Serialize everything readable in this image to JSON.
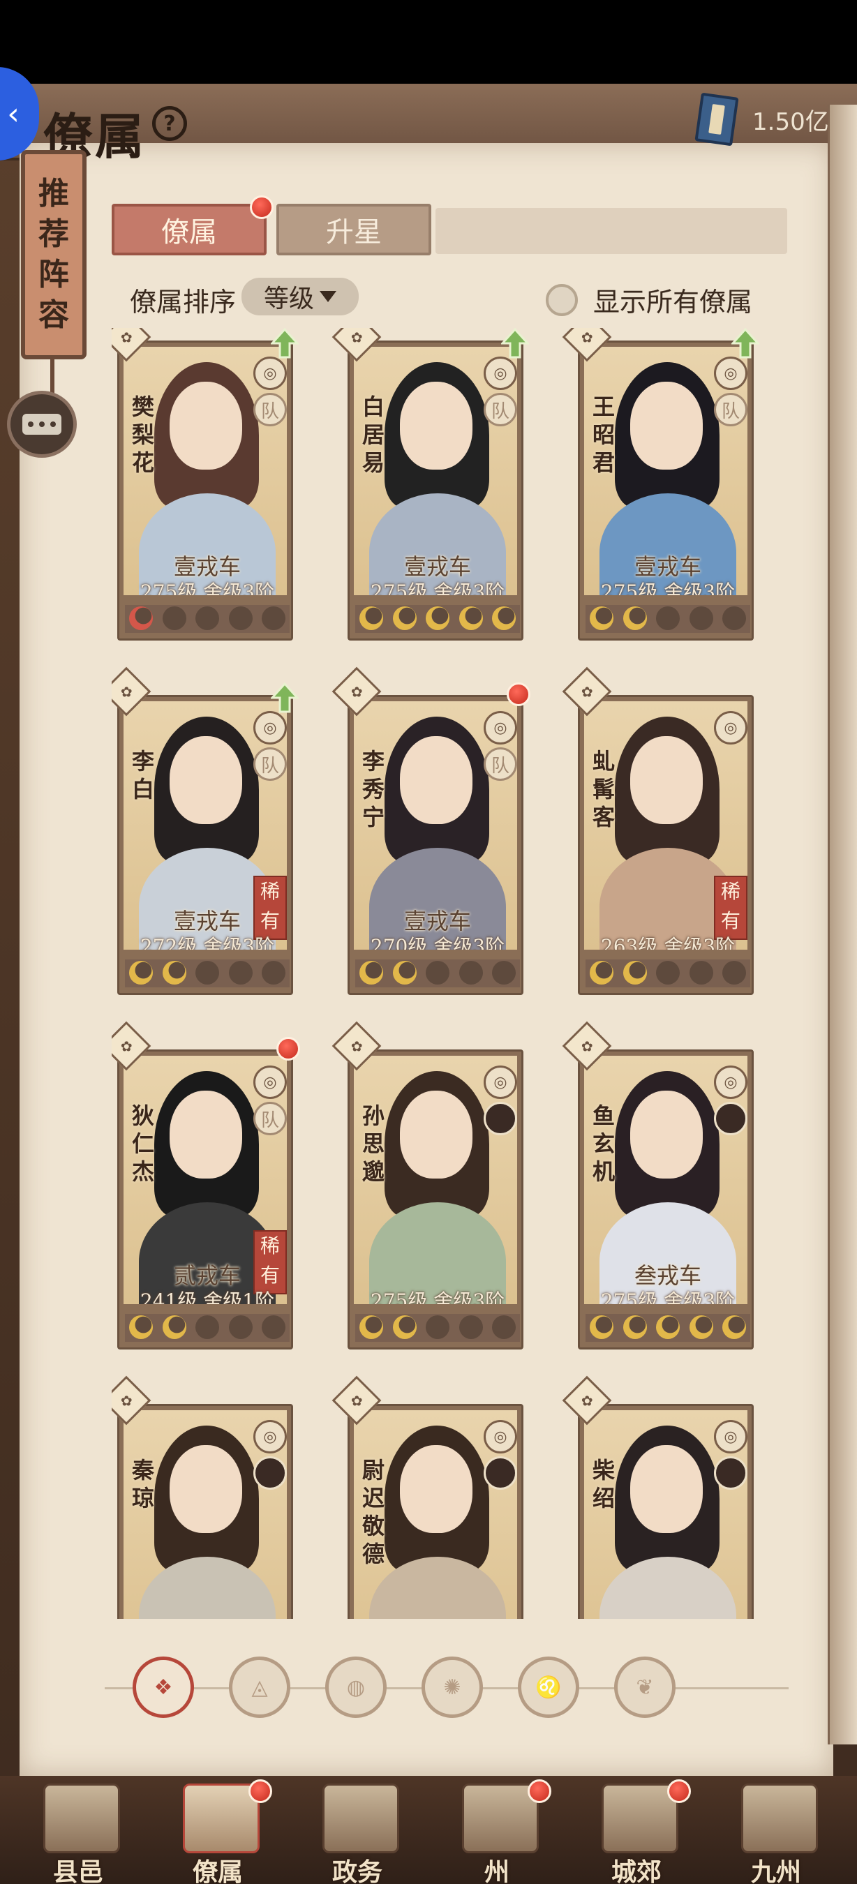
{
  "header": {
    "title": "僚属",
    "help": "?",
    "currency_value": "1.50亿"
  },
  "sidebar": {
    "recommend_label": [
      "推",
      "荐",
      "阵",
      "容"
    ]
  },
  "tabs": [
    {
      "label": "僚属",
      "active": true,
      "dot": true
    },
    {
      "label": "升星",
      "active": false,
      "dot": false
    }
  ],
  "sort": {
    "label": "僚属排序",
    "value": "等级",
    "show_all_label": "显示所有僚属"
  },
  "cards": [
    {
      "name": "樊梨花",
      "rank": "壹戎车",
      "level": "275级",
      "stage": "舍级3阶",
      "stars": 1,
      "star_color": "red",
      "upgrade": true,
      "rare": false,
      "team": "队",
      "dot": false
    },
    {
      "name": "白居易",
      "rank": "壹戎车",
      "level": "275级",
      "stage": "舍级3阶",
      "stars": 5,
      "star_color": "gold",
      "upgrade": true,
      "rare": false,
      "team": "队",
      "dot": false
    },
    {
      "name": "王昭君",
      "rank": "壹戎车",
      "level": "275级",
      "stage": "舍级3阶",
      "stars": 2,
      "star_color": "gold",
      "upgrade": true,
      "rare": false,
      "team": "队",
      "dot": false
    },
    {
      "name": "李白",
      "rank": "壹戎车",
      "level": "272级",
      "stage": "舍级3阶",
      "stars": 2,
      "star_color": "gold",
      "upgrade": true,
      "rare": true,
      "team": "队",
      "dot": false
    },
    {
      "name": "李秀宁",
      "rank": "壹戎车",
      "level": "270级",
      "stage": "舍级3阶",
      "stars": 2,
      "star_color": "gold",
      "upgrade": false,
      "rare": false,
      "team": "队",
      "dot": true
    },
    {
      "name": "虬髯客",
      "rank": "",
      "level": "263级",
      "stage": "舍级3阶",
      "stars": 2,
      "star_color": "gold",
      "upgrade": false,
      "rare": true,
      "team": "",
      "dot": false
    },
    {
      "name": "狄仁杰",
      "rank": "贰戎车",
      "level": "241级",
      "stage": "舍级1阶",
      "stars": 2,
      "star_color": "gold",
      "upgrade": false,
      "rare": true,
      "team": "队",
      "dot": true
    },
    {
      "name": "孙思邈",
      "rank": "",
      "level": "275级",
      "stage": "舍级3阶",
      "stars": 2,
      "star_color": "gold",
      "upgrade": false,
      "rare": false,
      "team": "",
      "dot": false
    },
    {
      "name": "鱼玄机",
      "rank": "叁戎车",
      "level": "275级",
      "stage": "舍级3阶",
      "stars": 5,
      "star_color": "gold",
      "upgrade": false,
      "rare": false,
      "team": "",
      "dot": false
    },
    {
      "name": "秦琼",
      "rank": "",
      "level": "",
      "stage": "",
      "stars": 0,
      "star_color": "gold",
      "upgrade": false,
      "rare": false,
      "team": "",
      "dot": false
    },
    {
      "name": "尉迟敬德",
      "rank": "",
      "level": "",
      "stage": "",
      "stars": 0,
      "star_color": "gold",
      "upgrade": false,
      "rare": false,
      "team": "",
      "dot": false
    },
    {
      "name": "柴绍",
      "rank": "",
      "level": "",
      "stage": "",
      "stars": 0,
      "star_color": "gold",
      "upgrade": false,
      "rare": false,
      "team": "",
      "dot": false
    }
  ],
  "rare_label": "稀有",
  "filters": [
    "all-filter-icon",
    "bell-filter-icon",
    "cat-filter-icon",
    "fan-filter-icon",
    "lion-filter-icon",
    "leaf-filter-icon"
  ],
  "bottom_nav": [
    {
      "label": "县邑",
      "dot": false,
      "active": false
    },
    {
      "label": "僚属",
      "dot": true,
      "active": true
    },
    {
      "label": "政务",
      "dot": false,
      "active": false
    },
    {
      "label": "州",
      "dot": true,
      "active": false
    },
    {
      "label": "城郊",
      "dot": true,
      "active": false
    },
    {
      "label": "九州",
      "dot": false,
      "active": false
    }
  ],
  "colors": {
    "accent": "#b6473a",
    "parchment": "#efe4d2",
    "star_gold": "#e2b84a"
  }
}
